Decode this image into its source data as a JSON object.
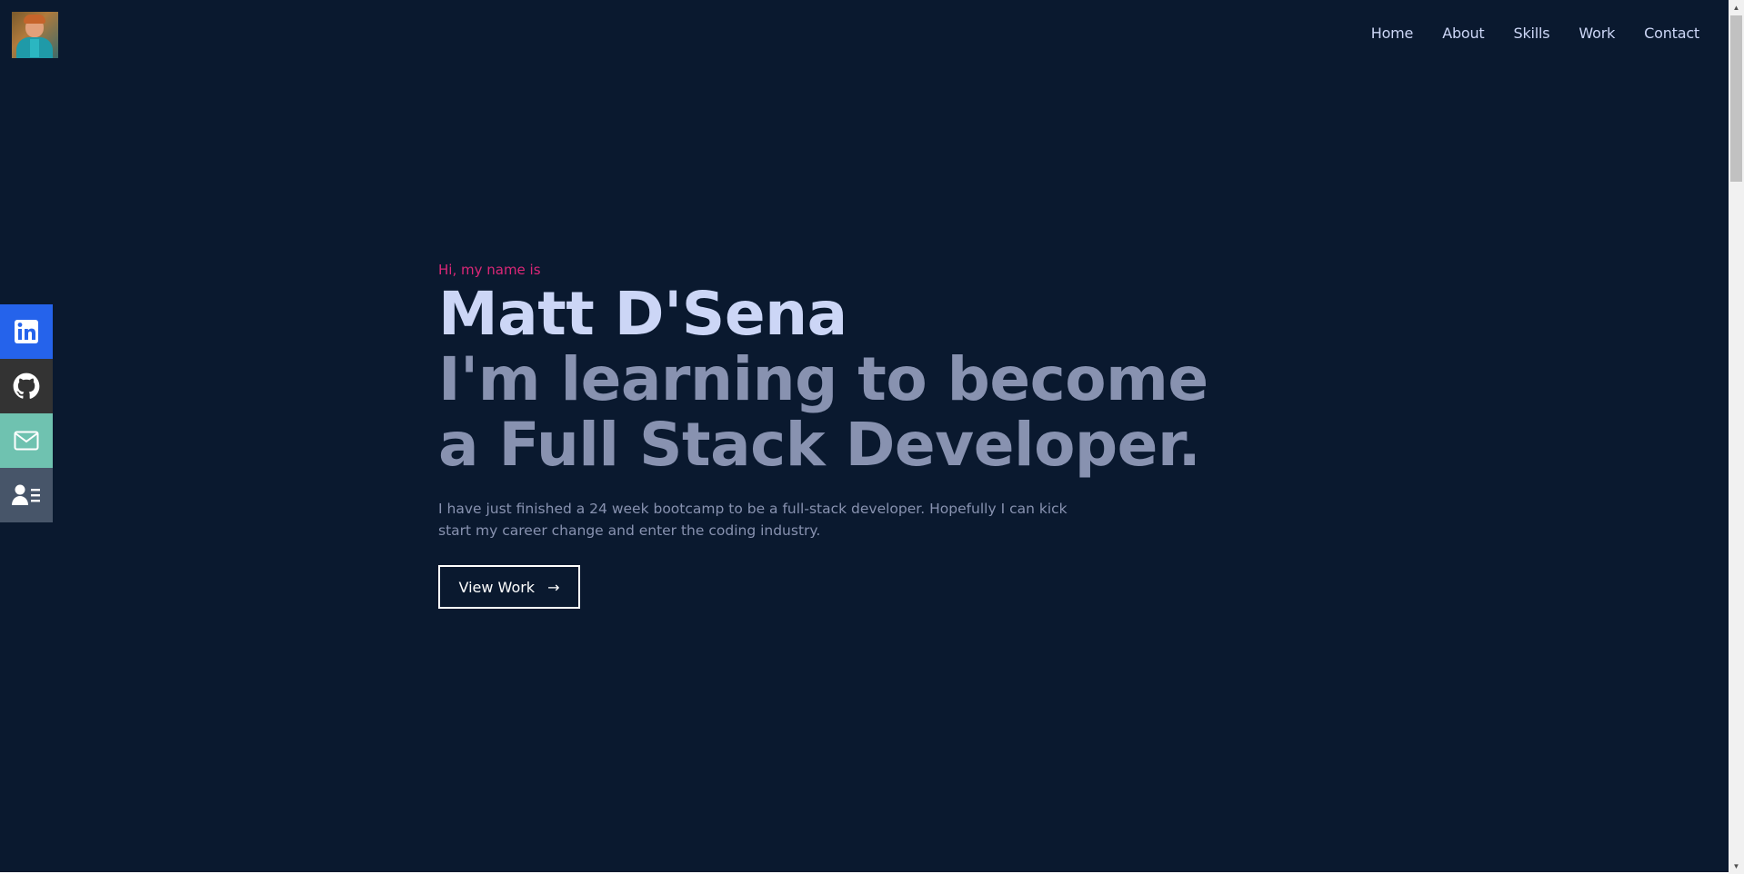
{
  "header": {
    "nav": [
      "Home",
      "About",
      "Skills",
      "Work",
      "Contact"
    ]
  },
  "social": {
    "items": [
      {
        "name": "linkedin-icon",
        "color": "#2563eb"
      },
      {
        "name": "github-icon",
        "color": "#333333"
      },
      {
        "name": "mail-icon",
        "color": "#6fc2b0"
      },
      {
        "name": "resume-icon",
        "color": "#475569"
      }
    ]
  },
  "hero": {
    "intro": "Hi, my name is",
    "name": "Matt D'Sena",
    "tagline": "I'm learning to become a Full Stack Developer.",
    "description": "I have just finished a 24 week bootcamp to be a full-stack developer. Hopefully I can kick start my career change and enter the coding industry.",
    "cta_label": "View Work",
    "cta_arrow": "→"
  },
  "theme": {
    "background": "#0a192f",
    "heading": "#ccd6f6",
    "subtle": "#8892b0",
    "accent": "#db2777"
  }
}
